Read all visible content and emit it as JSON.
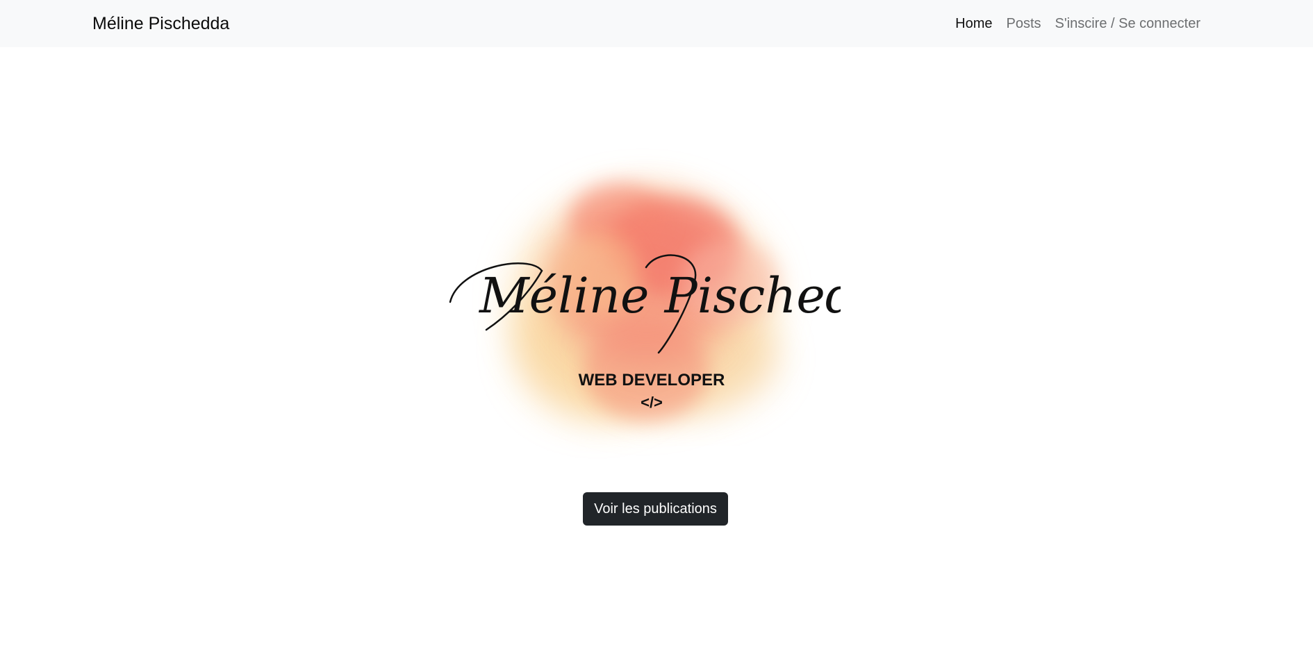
{
  "navbar": {
    "brand": "Méline Pischedda",
    "links": [
      {
        "label": "Home",
        "active": true
      },
      {
        "label": "Posts",
        "active": false
      },
      {
        "label": "S'inscire / Se connecter",
        "active": false
      }
    ]
  },
  "logo": {
    "signature": "Méline Pischedda",
    "subtitle": "WEB DEVELOPER",
    "code_symbol": "</>",
    "colors": {
      "splash_main": "#f47b6b",
      "splash_light": "#f9d49a",
      "ink": "#111111"
    }
  },
  "cta": {
    "label": "Voir les publications",
    "background": "#212529"
  }
}
